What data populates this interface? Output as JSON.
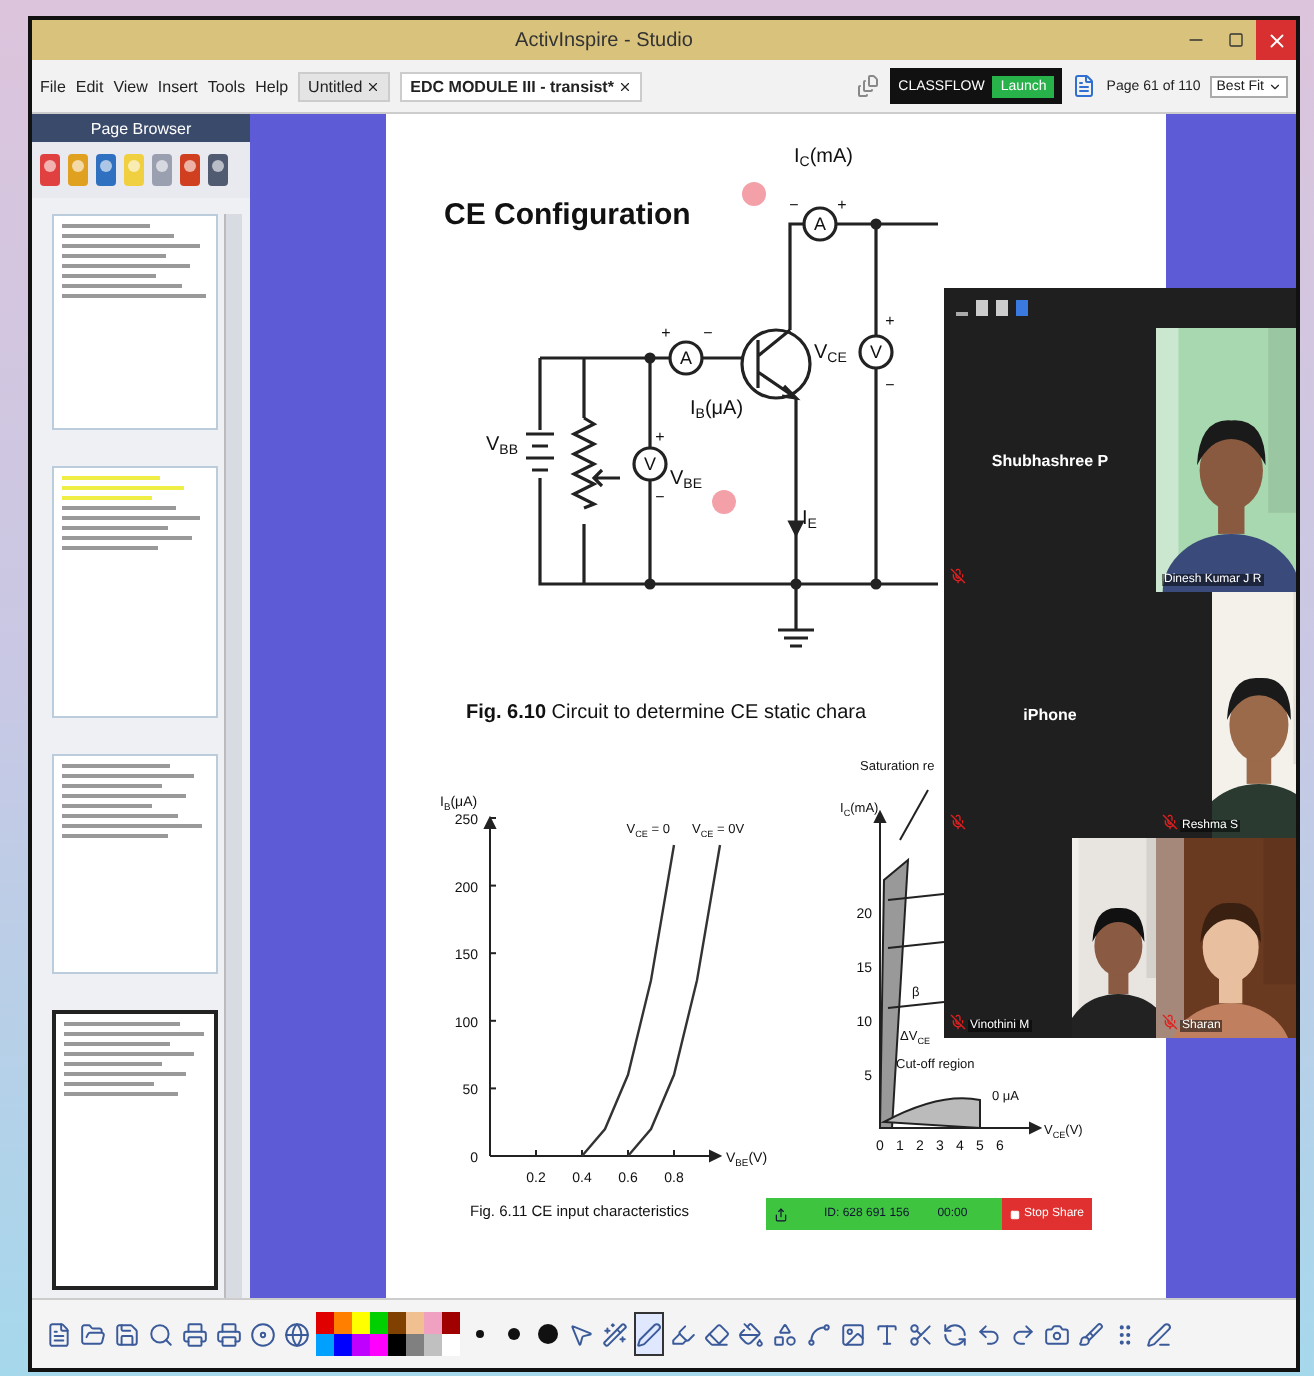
{
  "window": {
    "title": "ActivInspire - Studio"
  },
  "menu": [
    "File",
    "Edit",
    "View",
    "Insert",
    "Tools",
    "Help"
  ],
  "documents": [
    {
      "label": "Untitled",
      "selected": false
    },
    {
      "label": "EDC MODULE III - transist*",
      "selected": true
    }
  ],
  "classflow": {
    "label": "CLASSFLOW",
    "button": "Launch"
  },
  "page_indicator": "Page 61 of 110",
  "zoom": {
    "value": "Best Fit"
  },
  "page_browser": {
    "title": "Page Browser",
    "pages": [
      {
        "selected": false
      },
      {
        "selected": false
      },
      {
        "selected": false
      },
      {
        "selected": true
      }
    ]
  },
  "slide": {
    "title": "CE Configuration",
    "circuit": {
      "labels": [
        "I$_{C}$(mA)",
        "V$_{CE}$",
        "I$_{B}$(μA)",
        "V$_{BE}$",
        "V$_{BB}$",
        "I$_{E}$"
      ],
      "meters": [
        {
          "symbol": "A",
          "plus": "+",
          "minus": "−"
        },
        {
          "symbol": "A",
          "plus": "+",
          "minus": "−"
        },
        {
          "symbol": "V",
          "plus": "+",
          "minus": "−"
        },
        {
          "symbol": "V",
          "plus": "+",
          "minus": "−"
        }
      ]
    },
    "caption": "**Fig. 6.10**   Circuit to determine CE static chara",
    "input_chart": {
      "chart_data": {
        "type": "line",
        "title": "Fig. 6.11  CE input characteristics",
        "xlabel": "V$_{BE}$(V)",
        "ylabel": "I$_{B}$(μA)",
        "x": [
          0.4,
          0.5,
          0.6,
          0.7,
          0.8,
          0.9,
          1.0
        ],
        "series": [
          {
            "name": "V$_{CE}$ = 0",
            "color": "#333333",
            "values": [
              0,
              20,
              60,
              130,
              230,
              null,
              null
            ]
          },
          {
            "name": "V$_{CE}$ = 0V",
            "color": "#333333",
            "values": [
              null,
              null,
              0,
              20,
              60,
              130,
              230
            ]
          }
        ],
        "xlim": [
          0,
          1.0
        ],
        "ylim": [
          0,
          250
        ],
        "xticks": [
          0.2,
          0.4,
          0.6,
          0.8
        ],
        "yticks": [
          0,
          50,
          100,
          150,
          200,
          250
        ]
      }
    },
    "output_figure": {
      "labels": [
        "Saturation re",
        "I$_{C}$(mA)",
        "Cut-off region",
        "0 μA",
        "V$_{CE}$(V)",
        "β",
        "ΔV$_{CE}$"
      ],
      "yticks": [
        "20",
        "15",
        "10",
        "5"
      ],
      "xticks": [
        "0",
        "1",
        "2",
        "3",
        "4",
        "5",
        "6"
      ]
    }
  },
  "meeting": {
    "tiles": [
      {
        "kind": "name",
        "name": "Shubhashree P",
        "muted": true
      },
      {
        "kind": "video",
        "name": "Dinesh Kumar J R",
        "muted": false
      },
      {
        "kind": "name",
        "name": "iPhone",
        "muted": true
      },
      {
        "kind": "video",
        "name": "Reshma S",
        "muted": true
      },
      {
        "kind": "video",
        "name": "Vinothini M",
        "muted": true
      },
      {
        "kind": "video",
        "name": "Sharan",
        "muted": true
      }
    ],
    "share_bar": {
      "id": "ID: 628 691 156",
      "timer": "00:00",
      "stop": "Stop Share"
    }
  },
  "toolbar": {
    "tools": [
      {
        "selected": false
      },
      {
        "selected": false
      },
      {
        "selected": false
      },
      {
        "selected": false
      },
      {
        "selected": false
      },
      {
        "selected": false
      },
      {
        "selected": false
      },
      {
        "selected": false
      },
      {
        "selected": false
      },
      {
        "selected": false
      },
      {
        "selected": false
      },
      {
        "selected": false
      },
      {
        "selected": false
      },
      {
        "selected": true
      },
      {
        "selected": false
      },
      {
        "selected": false
      },
      {
        "selected": false
      },
      {
        "selected": false
      },
      {
        "selected": false
      },
      {
        "selected": false
      },
      {
        "selected": false
      },
      {
        "selected": false
      },
      {
        "selected": false
      },
      {
        "selected": false
      },
      {
        "selected": false
      },
      {
        "selected": false
      },
      {
        "selected": false
      },
      {
        "selected": false
      },
      {
        "selected": false
      }
    ],
    "swatches": [
      {
        "color": "#e00000"
      },
      {
        "color": "#ff8000"
      },
      {
        "color": "#ffff00"
      },
      {
        "color": "#00d000"
      },
      {
        "color": "#804000"
      },
      {
        "color": "#f0c090"
      },
      {
        "color": "#f0a0c0"
      },
      {
        "color": "#a00000"
      },
      {
        "color": "#00a0ff"
      },
      {
        "color": "#0000ff"
      },
      {
        "color": "#c000ff"
      },
      {
        "color": "#ff00ff"
      },
      {
        "color": "#000000"
      },
      {
        "color": "#808080"
      },
      {
        "color": "#c0c0c0"
      },
      {
        "color": "#ffffff"
      }
    ]
  }
}
